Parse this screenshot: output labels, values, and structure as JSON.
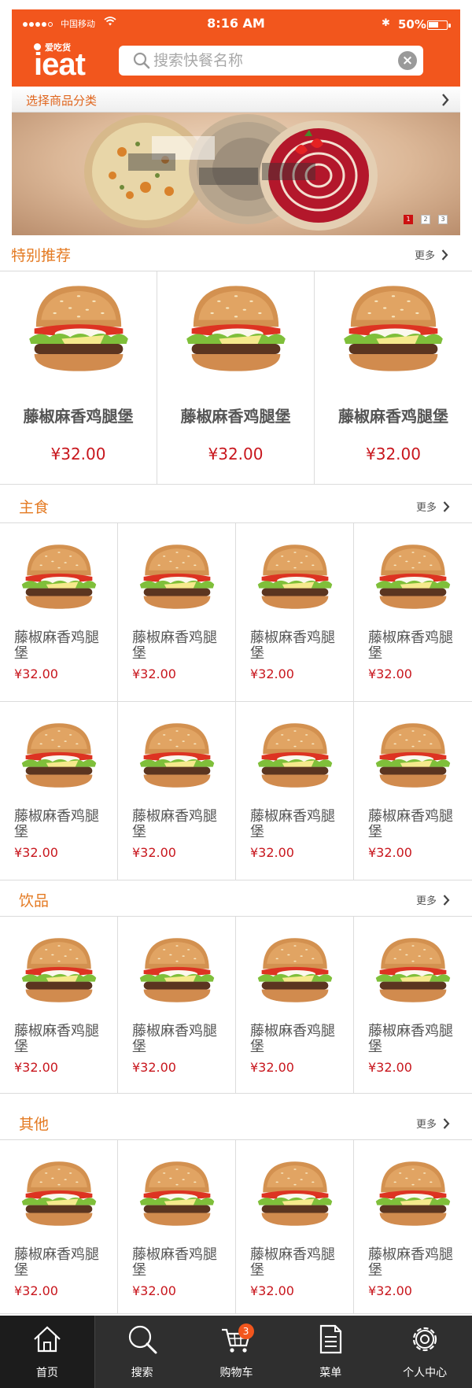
{
  "status_bar": {
    "carrier": "中国移动",
    "time": "8:16 AM",
    "battery": "50%",
    "battery_level": 0.5
  },
  "header": {
    "logo_text": "ieat",
    "logo_small": "爱吃货",
    "search_placeholder": "搜索快餐名称"
  },
  "category_bar": {
    "label": "选择商品分类"
  },
  "banner": {
    "pages": [
      "1",
      "2",
      "3"
    ],
    "active_page": 1
  },
  "colors": {
    "brand": "#f2561d",
    "price": "#c8161d",
    "section_title": "#e47a22",
    "tabbar": "#2f2f2f"
  },
  "sections": [
    {
      "title": "特别推荐",
      "more": "更多",
      "rows": [
        [
          {
            "name": "藤椒麻香鸡腿堡",
            "price": "¥32.00"
          },
          {
            "name": "藤椒麻香鸡腿堡",
            "price": "¥32.00"
          },
          {
            "name": "藤椒麻香鸡腿堡",
            "price": "¥32.00"
          }
        ]
      ]
    },
    {
      "title": "主食",
      "more": "更多",
      "rows": [
        [
          {
            "name": "藤椒麻香鸡腿堡",
            "price": "¥32.00"
          },
          {
            "name": "藤椒麻香鸡腿堡",
            "price": "¥32.00"
          },
          {
            "name": "藤椒麻香鸡腿堡",
            "price": "¥32.00"
          },
          {
            "name": "藤椒麻香鸡腿堡",
            "price": "¥32.00"
          }
        ],
        [
          {
            "name": "藤椒麻香鸡腿堡",
            "price": "¥32.00"
          },
          {
            "name": "藤椒麻香鸡腿堡",
            "price": "¥32.00"
          },
          {
            "name": "藤椒麻香鸡腿堡",
            "price": "¥32.00"
          },
          {
            "name": "藤椒麻香鸡腿堡",
            "price": "¥32.00"
          }
        ]
      ]
    },
    {
      "title": "饮品",
      "more": "更多",
      "rows": [
        [
          {
            "name": "藤椒麻香鸡腿堡",
            "price": "¥32.00"
          },
          {
            "name": "藤椒麻香鸡腿堡",
            "price": "¥32.00"
          },
          {
            "name": "藤椒麻香鸡腿堡",
            "price": "¥32.00"
          },
          {
            "name": "藤椒麻香鸡腿堡",
            "price": "¥32.00"
          }
        ]
      ]
    },
    {
      "title": "其他",
      "more": "更多",
      "rows": [
        [
          {
            "name": "藤椒麻香鸡腿堡",
            "price": "¥32.00"
          },
          {
            "name": "藤椒麻香鸡腿堡",
            "price": "¥32.00"
          },
          {
            "name": "藤椒麻香鸡腿堡",
            "price": "¥32.00"
          },
          {
            "name": "藤椒麻香鸡腿堡",
            "price": "¥32.00"
          }
        ]
      ]
    }
  ],
  "tabbar": {
    "items": [
      {
        "label": "首页",
        "icon": "home-icon"
      },
      {
        "label": "搜索",
        "icon": "search-icon"
      },
      {
        "label": "购物车",
        "icon": "cart-icon",
        "badge": "3"
      },
      {
        "label": "菜单",
        "icon": "menu-icon"
      },
      {
        "label": "个人中心",
        "icon": "settings-icon"
      }
    ]
  }
}
